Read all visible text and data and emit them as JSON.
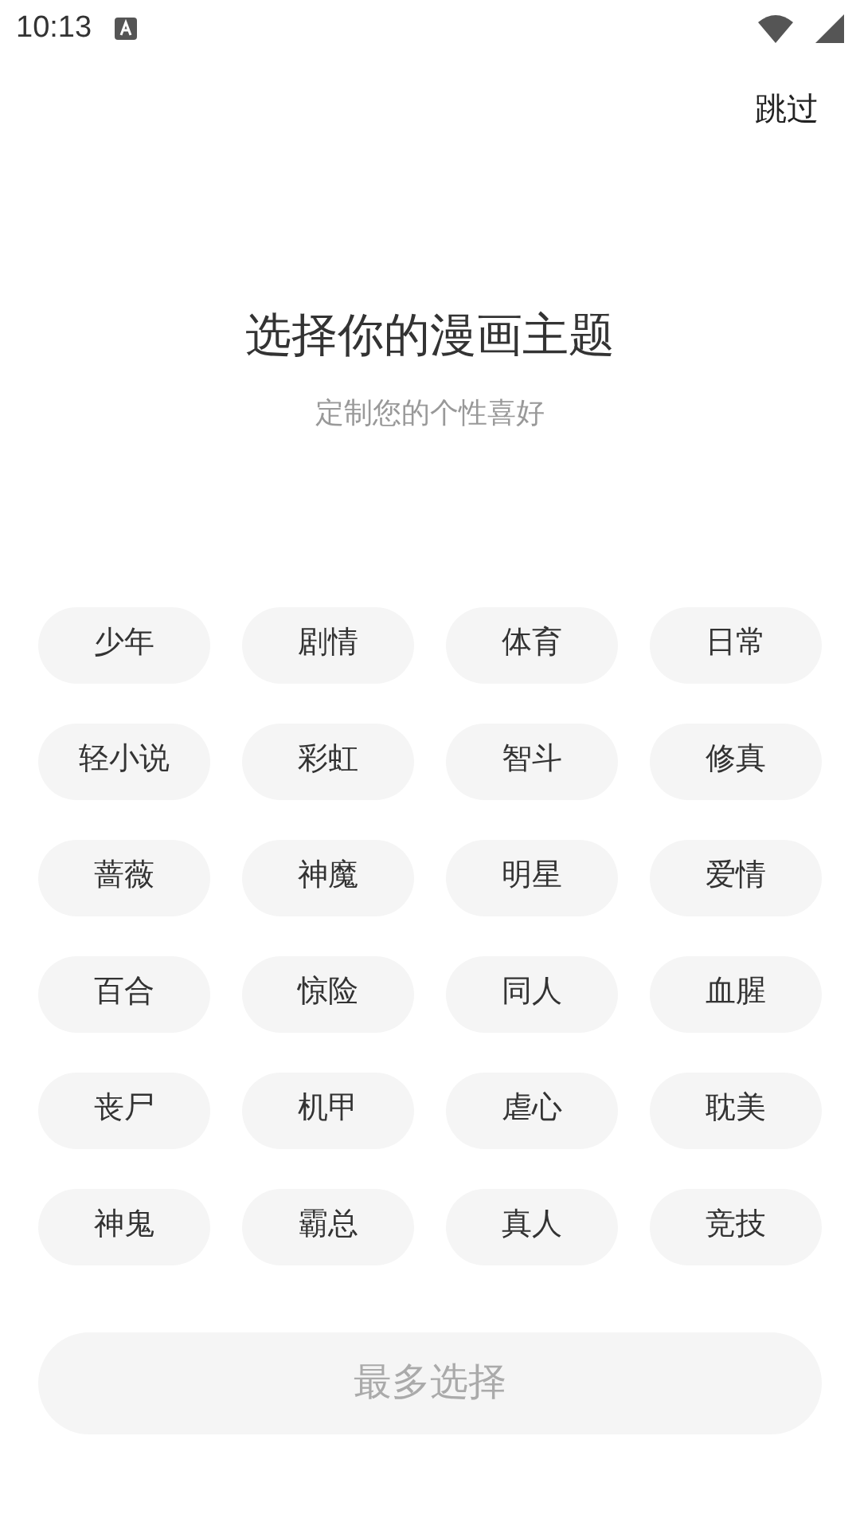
{
  "status_bar": {
    "time": "10:13"
  },
  "skip": "跳过",
  "title": "选择你的漫画主题",
  "subtitle": "定制您的个性喜好",
  "tags": [
    {
      "label": "少年",
      "selected": false
    },
    {
      "label": "剧情",
      "selected": false
    },
    {
      "label": "体育",
      "selected": false
    },
    {
      "label": "日常",
      "selected": false
    },
    {
      "label": "轻小说",
      "selected": false
    },
    {
      "label": "彩虹",
      "selected": false
    },
    {
      "label": "智斗",
      "selected": false
    },
    {
      "label": "修真",
      "selected": false
    },
    {
      "label": "蔷薇",
      "selected": false
    },
    {
      "label": "神魔",
      "selected": false
    },
    {
      "label": "明星",
      "selected": false
    },
    {
      "label": "爱情",
      "selected": false
    },
    {
      "label": "百合",
      "selected": false
    },
    {
      "label": "惊险",
      "selected": false
    },
    {
      "label": "同人",
      "selected": false
    },
    {
      "label": "血腥",
      "selected": false
    },
    {
      "label": "丧尸",
      "selected": false
    },
    {
      "label": "机甲",
      "selected": false
    },
    {
      "label": "虐心",
      "selected": false
    },
    {
      "label": "耽美",
      "selected": false
    },
    {
      "label": "神鬼",
      "selected": false
    },
    {
      "label": "霸总",
      "selected": false
    },
    {
      "label": "真人",
      "selected": false
    },
    {
      "label": "竞技",
      "selected": false
    }
  ],
  "confirm_button": {
    "label": "最多选择",
    "disabled": true
  }
}
